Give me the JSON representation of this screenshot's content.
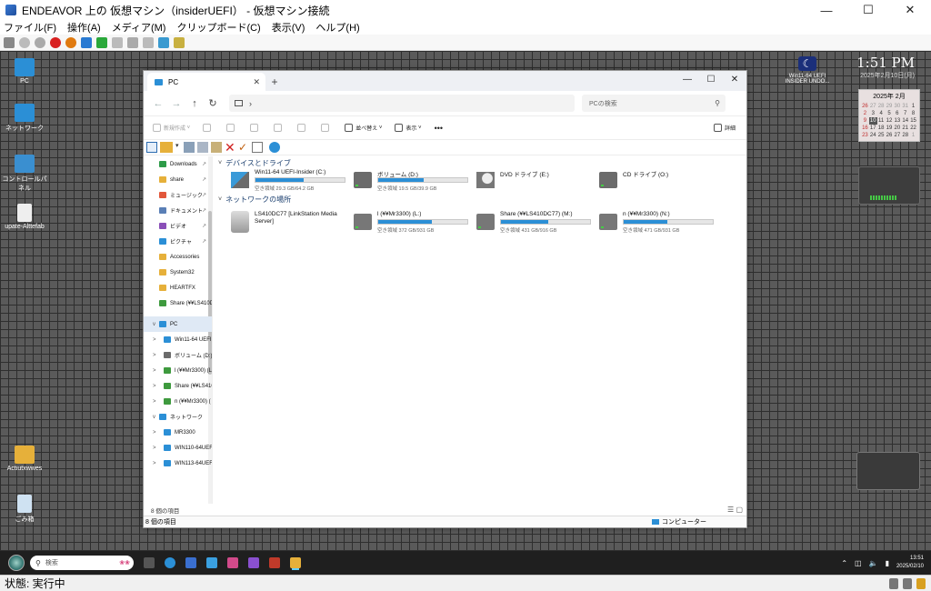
{
  "vm": {
    "title": "ENDEAVOR 上の 仮想マシン（insiderUEFI） - 仮想マシン接続",
    "menu": [
      "ファイル(F)",
      "操作(A)",
      "メディア(M)",
      "クリップボード(C)",
      "表示(V)",
      "ヘルプ(H)"
    ],
    "status": "状態: 実行中"
  },
  "desktop": {
    "icons": [
      "PC",
      "ネットワーク",
      "コントロールパネル",
      "upate-Alttefab",
      "Actiutxwwes",
      "ごみ箱"
    ],
    "clock_time": "1:51 PM",
    "clock_date": "2025年2月10日(月)",
    "moon_label": "Win11-64 UEFI INSIDER UNDO...",
    "calendar_head": "2025年 2月",
    "calendar_days": [
      "26",
      "27",
      "28",
      "29",
      "30",
      "31",
      "1",
      "2",
      "3",
      "4",
      "5",
      "6",
      "7",
      "8",
      "9",
      "10",
      "11",
      "12",
      "13",
      "14",
      "15",
      "16",
      "17",
      "18",
      "19",
      "20",
      "21",
      "22",
      "23",
      "24",
      "25",
      "26",
      "27",
      "28",
      "1"
    ]
  },
  "explorer": {
    "tab_label": "PC",
    "search_placeholder": "PCの検索",
    "cmd": {
      "new": "新規作成",
      "sort": "並べ替え",
      "view": "表示",
      "more": "•••",
      "details": "詳細"
    },
    "nav_quick": [
      {
        "label": "Downloads",
        "color": "#2d9b48"
      },
      {
        "label": "share",
        "color": "#e6b03a"
      },
      {
        "label": "ミュージック",
        "color": "#e2573b"
      },
      {
        "label": "ドキュメント",
        "color": "#5a7fb6"
      },
      {
        "label": "ビデオ",
        "color": "#8a4fb8"
      },
      {
        "label": "ピクチャ",
        "color": "#2b8fd6"
      },
      {
        "label": "Accessories",
        "color": "#e6b03a"
      },
      {
        "label": "System32",
        "color": "#e6b03a"
      },
      {
        "label": "HEARTFX",
        "color": "#e6b03a"
      },
      {
        "label": "Share (¥¥LS410D",
        "color": "#3e9a3e"
      }
    ],
    "nav_pc_label": "PC",
    "nav_pc_children": [
      "Win11-64 UEFI",
      "ボリューム (D:)",
      "l (¥¥Mr3300) (L",
      "Share (¥¥LS410",
      "n (¥¥Mr3300) ("
    ],
    "nav_network_label": "ネットワーク",
    "nav_network_children": [
      "MR3300",
      "WIN110-64UEF",
      "WIN113-64UEF"
    ],
    "group_devices": "デバイスとドライブ",
    "group_network": "ネットワークの場所",
    "drives": [
      {
        "name": "Win11-64 UEFI-Insider (C:)",
        "free": "空き領域 29.3 GB/64.2 GB",
        "used": 0.54,
        "type": "win"
      },
      {
        "name": "ボリューム (D:)",
        "free": "空き領域 19.5 GB/39.9 GB",
        "used": 0.51,
        "type": "hdd"
      },
      {
        "name": "DVD ドライブ (E:)",
        "free": "",
        "used": null,
        "type": "dvd"
      },
      {
        "name": "CD ドライブ (O:)",
        "free": "",
        "used": null,
        "type": "cd"
      }
    ],
    "net_locations": [
      {
        "name": "LS410DC77 [LinkStation Media Server]",
        "free": "",
        "used": null,
        "type": "media"
      },
      {
        "name": "l (¥¥Mr3300) (L:)",
        "free": "空き領域 372 GB/931 GB",
        "used": 0.6,
        "type": "net"
      },
      {
        "name": "Share (¥¥LS410DC77) (M:)",
        "free": "空き領域 431 GB/916 GB",
        "used": 0.53,
        "type": "net"
      },
      {
        "name": "n (¥¥Mr3300) (N:)",
        "free": "空き領域 471 GB/931 GB",
        "used": 0.49,
        "type": "net"
      }
    ],
    "item_count": "8 個の項目",
    "status_left": "8 個の項目",
    "status_right": "コンピューター"
  },
  "taskbar": {
    "search_placeholder": "検索",
    "time": "13:51",
    "date": "2025/02/10"
  }
}
